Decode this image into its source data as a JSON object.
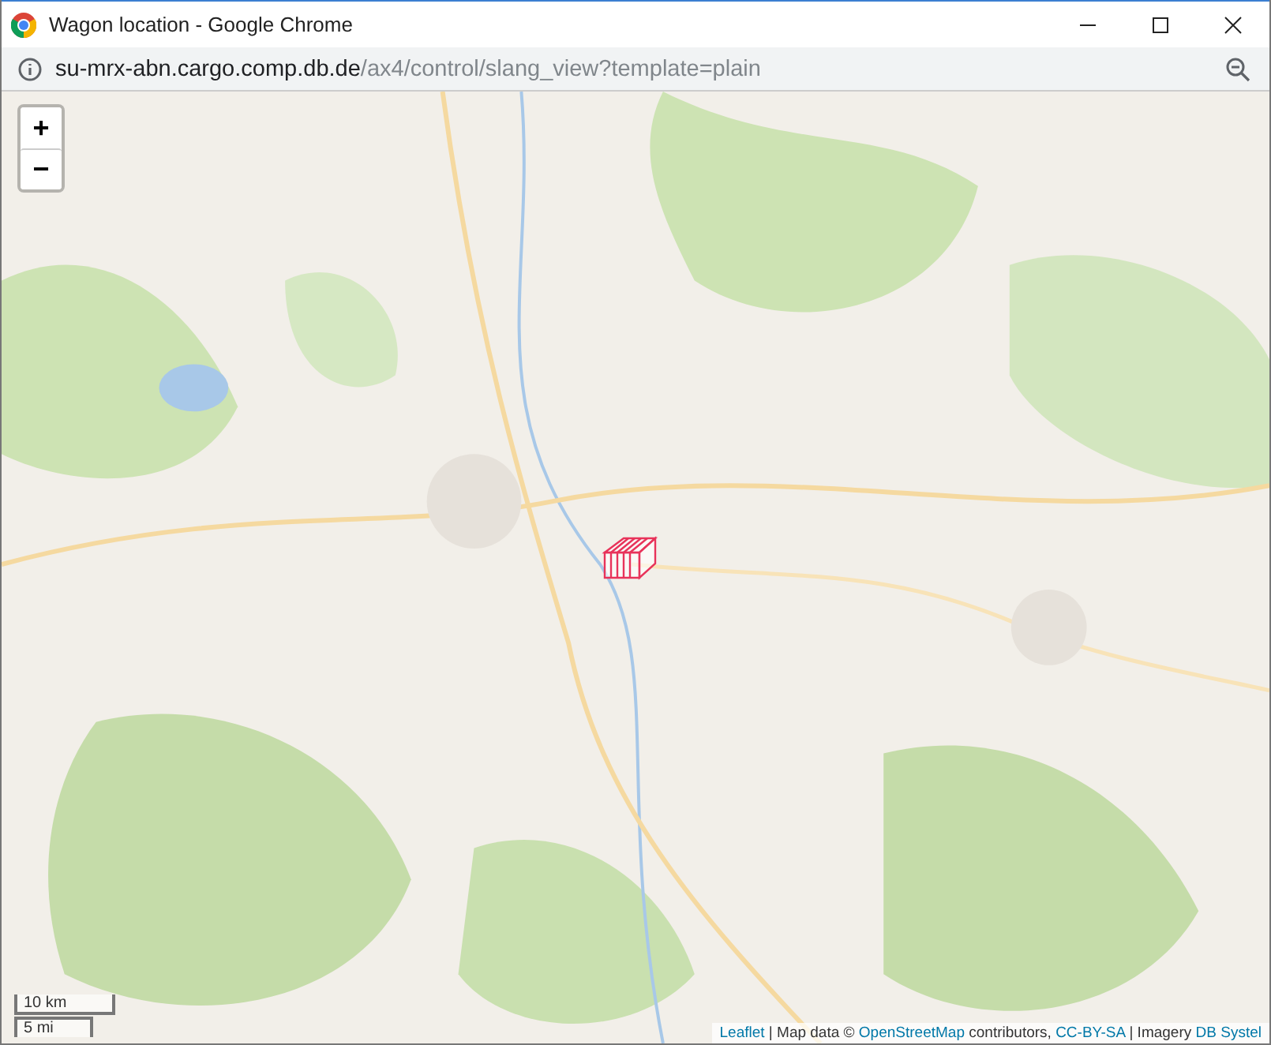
{
  "window": {
    "title": "Wagon location - Google Chrome"
  },
  "address_bar": {
    "host": "su-mrx-abn.cargo.comp.db.de",
    "path": "/ax4/control/slang_view?template=plain"
  },
  "map": {
    "kind": "picture",
    "zoom_controls": [
      "+",
      "−"
    ],
    "scale": [
      "10 km",
      "5 mi"
    ],
    "attribution": [
      {
        "kind": "link",
        "text": "Leaflet"
      },
      {
        "kind": "text",
        "text": "| Map data ©"
      },
      {
        "kind": "link",
        "text": "OpenStreetMap"
      },
      {
        "kind": "text",
        "text": "contributors,"
      },
      {
        "kind": "link",
        "text": "CC-BY-SA"
      },
      {
        "kind": "text",
        "text": "| Imagery"
      },
      {
        "kind": "link",
        "text": "DB Systel"
      }
    ]
  }
}
